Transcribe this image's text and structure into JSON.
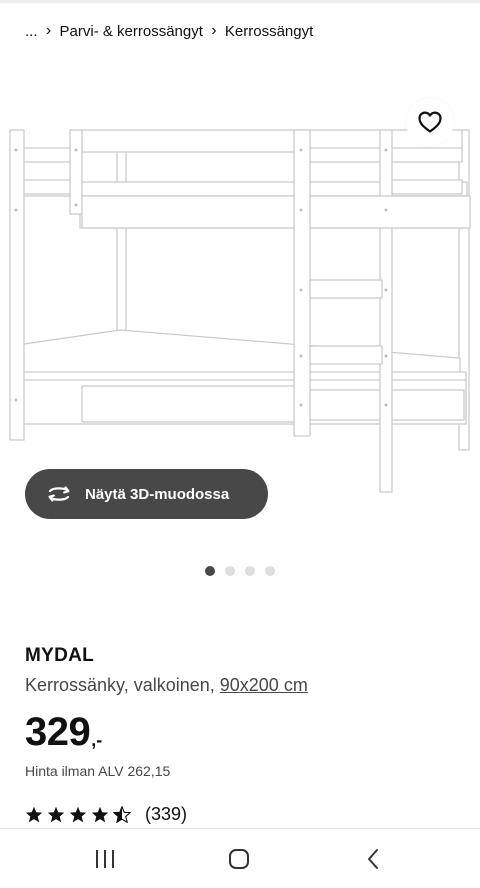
{
  "breadcrumb": {
    "items": [
      "...",
      "Parvi- & kerrossängyt",
      "Kerrossängyt"
    ],
    "separator": "›"
  },
  "gallery": {
    "image": "white-bunk-bed-icon",
    "slide_count": 4,
    "active_index": 0,
    "view_3d_label": "Näytä 3D-muodossa",
    "view_3d_icon": "rotate-3d-icon",
    "favourite_icon": "heart-outline-icon"
  },
  "product": {
    "name": "MYDAL",
    "description": "Kerrossänky, valkoinen, ",
    "size": "90x200 cm",
    "price": {
      "main": "329",
      "decimals": ",-"
    },
    "vat_note": "Hinta ilman ALV 262,15",
    "rating": {
      "value": 4.5,
      "max": 5,
      "count": "(339)"
    }
  },
  "system_nav": {
    "items": [
      "recent-apps-icon",
      "home-icon",
      "back-icon"
    ]
  },
  "colors": {
    "button_bg": "#484848",
    "text": "#111111",
    "secondary_text": "#484848",
    "dot_inactive": "#dfdfdf"
  }
}
